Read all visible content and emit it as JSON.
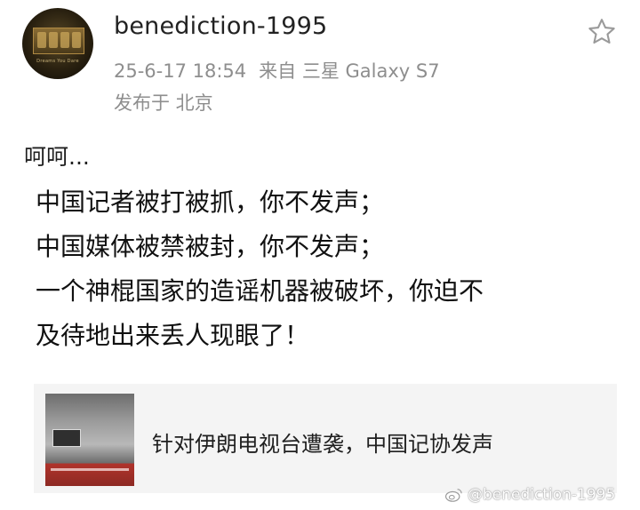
{
  "post": {
    "username": "benediction-1995",
    "datetime": "25-6-17 18:54",
    "source": "来自 三星 Galaxy S7",
    "location": "发布于 北京",
    "intro": "呵呵...",
    "lines": [
      "中国记者被打被抓，你不发声；",
      "中国媒体被禁被封，你不发声；",
      "一个神棍国家的造谣机器被破坏，你迫不",
      "及待地出来丢人现眼了！"
    ],
    "star_icon": "star-outline-icon"
  },
  "avatar": {
    "caption": "Dreams You Dare"
  },
  "link_card": {
    "title": "针对伊朗电视台遭袭，中国记协发声"
  },
  "watermark": {
    "text": "@benediction-1995",
    "icon": "weibo-icon"
  }
}
